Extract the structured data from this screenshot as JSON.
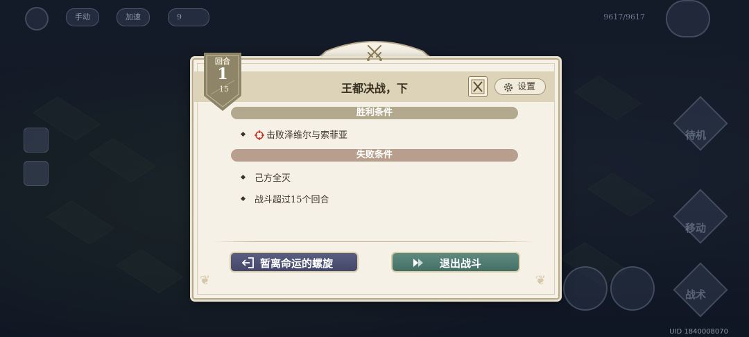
{
  "background": {
    "hud": {
      "mode_button": "手动",
      "speed_button": "加速",
      "turn_counter": "9",
      "player_hp": "9617/9617",
      "side_action_wait": "待机",
      "side_action_move": "移动",
      "side_action_battle": "战术"
    },
    "uid": "UID 1840008070"
  },
  "dialog": {
    "round": {
      "label": "回合",
      "current": "1",
      "total": "15"
    },
    "title": "王都决战，下",
    "settings_label": "设置",
    "victory": {
      "header": "胜利条件",
      "conditions": [
        "击败泽维尔与索菲亚"
      ]
    },
    "defeat": {
      "header": "失败条件",
      "conditions": [
        "己方全灭",
        "战斗超过15个回合"
      ]
    },
    "buttons": {
      "leave": "暂离命运的螺旋",
      "exit": "退出战斗"
    }
  },
  "colors": {
    "panel": "#f5f1e6",
    "header_band": "#ddd3b9",
    "victory_bar": "#b2a98e",
    "defeat_bar": "#b89f8d",
    "leave_button": "#4c5074",
    "exit_button": "#517b72",
    "target_icon": "#c0392b"
  },
  "icons": {
    "crossed_swords": "crossed-swords-icon",
    "map": "map-icon",
    "gear": "gear-icon",
    "target": "target-icon",
    "leave": "exit-door-icon",
    "exit": "fast-forward-icon"
  }
}
